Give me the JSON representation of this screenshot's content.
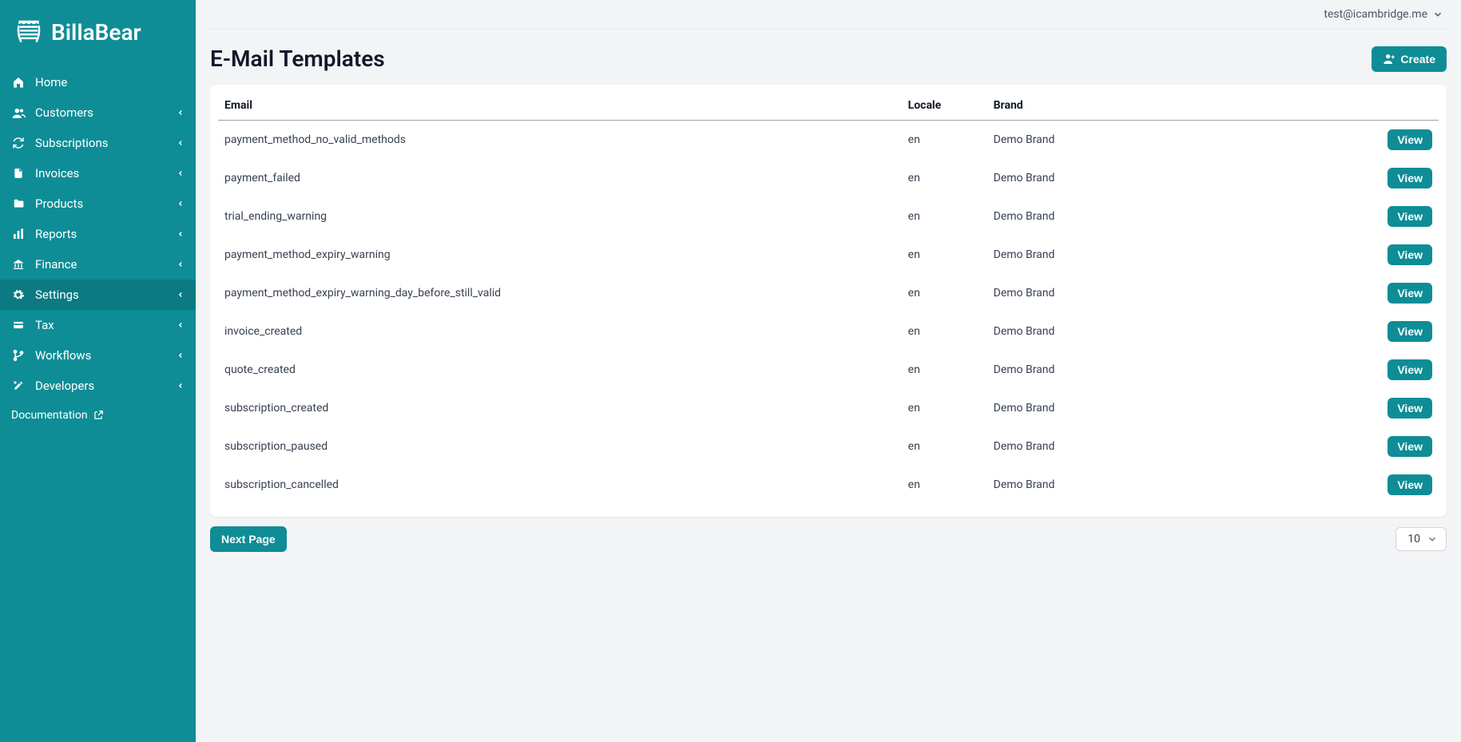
{
  "brand": {
    "name": "BillaBear"
  },
  "user": {
    "email": "test@icambridge.me"
  },
  "sidebar": {
    "items": [
      {
        "label": "Home",
        "icon": "home",
        "expandable": false,
        "active": false
      },
      {
        "label": "Customers",
        "icon": "users",
        "expandable": true,
        "active": false
      },
      {
        "label": "Subscriptions",
        "icon": "refresh",
        "expandable": true,
        "active": false
      },
      {
        "label": "Invoices",
        "icon": "file",
        "expandable": true,
        "active": false
      },
      {
        "label": "Products",
        "icon": "folder",
        "expandable": true,
        "active": false
      },
      {
        "label": "Reports",
        "icon": "chart",
        "expandable": true,
        "active": false
      },
      {
        "label": "Finance",
        "icon": "bank",
        "expandable": true,
        "active": false
      },
      {
        "label": "Settings",
        "icon": "gear",
        "expandable": true,
        "active": true
      },
      {
        "label": "Tax",
        "icon": "card",
        "expandable": true,
        "active": false
      },
      {
        "label": "Workflows",
        "icon": "branch",
        "expandable": true,
        "active": false
      },
      {
        "label": "Developers",
        "icon": "tools",
        "expandable": true,
        "active": false
      }
    ],
    "doc_link": "Documentation"
  },
  "page": {
    "title": "E-Mail Templates",
    "create_label": "Create",
    "next_page_label": "Next Page",
    "page_size_value": "10"
  },
  "table": {
    "headers": {
      "email": "Email",
      "locale": "Locale",
      "brand": "Brand"
    },
    "view_label": "View",
    "rows": [
      {
        "email": "payment_method_no_valid_methods",
        "locale": "en",
        "brand": "Demo Brand"
      },
      {
        "email": "payment_failed",
        "locale": "en",
        "brand": "Demo Brand"
      },
      {
        "email": "trial_ending_warning",
        "locale": "en",
        "brand": "Demo Brand"
      },
      {
        "email": "payment_method_expiry_warning",
        "locale": "en",
        "brand": "Demo Brand"
      },
      {
        "email": "payment_method_expiry_warning_day_before_still_valid",
        "locale": "en",
        "brand": "Demo Brand"
      },
      {
        "email": "invoice_created",
        "locale": "en",
        "brand": "Demo Brand"
      },
      {
        "email": "quote_created",
        "locale": "en",
        "brand": "Demo Brand"
      },
      {
        "email": "subscription_created",
        "locale": "en",
        "brand": "Demo Brand"
      },
      {
        "email": "subscription_paused",
        "locale": "en",
        "brand": "Demo Brand"
      },
      {
        "email": "subscription_cancelled",
        "locale": "en",
        "brand": "Demo Brand"
      }
    ]
  }
}
